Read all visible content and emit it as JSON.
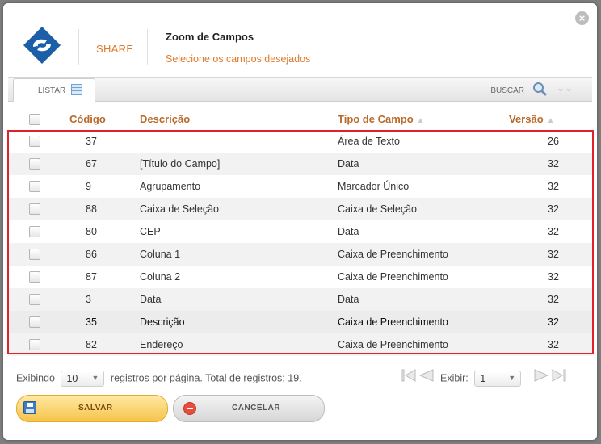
{
  "header": {
    "brand": "SHARE",
    "title": "Zoom de Campos",
    "subtitle": "Selecione os campos desejados",
    "close_icon": "×"
  },
  "toolbar": {
    "tab_label": "LISTAR",
    "search_label": "BUSCAR"
  },
  "table": {
    "columns": {
      "codigo": "Código",
      "descricao": "Descrição",
      "tipo": "Tipo de Campo",
      "versao": "Versão"
    },
    "rows": [
      {
        "codigo": "37",
        "descricao": "",
        "tipo": "Área de Texto",
        "versao": "26"
      },
      {
        "codigo": "67",
        "descricao": "[Título do Campo]",
        "tipo": "Data",
        "versao": "32"
      },
      {
        "codigo": "9",
        "descricao": "Agrupamento",
        "tipo": "Marcador Único",
        "versao": "32"
      },
      {
        "codigo": "88",
        "descricao": "Caixa de Seleção",
        "tipo": "Caixa de Seleção",
        "versao": "32"
      },
      {
        "codigo": "80",
        "descricao": "CEP",
        "tipo": "Data",
        "versao": "32"
      },
      {
        "codigo": "86",
        "descricao": "Coluna 1",
        "tipo": "Caixa de Preenchimento",
        "versao": "32"
      },
      {
        "codigo": "87",
        "descricao": "Coluna 2",
        "tipo": "Caixa de Preenchimento",
        "versao": "32"
      },
      {
        "codigo": "3",
        "descricao": "Data",
        "tipo": "Data",
        "versao": "32"
      },
      {
        "codigo": "35",
        "descricao": "Descrição",
        "tipo": "Caixa de Preenchimento",
        "versao": "32"
      },
      {
        "codigo": "82",
        "descricao": "Endereço",
        "tipo": "Caixa de Preenchimento",
        "versao": "32"
      }
    ]
  },
  "pager": {
    "showing_label": "Exibindo",
    "per_page": "10",
    "per_page_text": "registros por página. Total de registros: 19.",
    "exibir_label": "Exibir:",
    "page": "1"
  },
  "buttons": {
    "save": "SALVAR",
    "cancel": "CANCELAR"
  },
  "colors": {
    "accent": "#e07a2a",
    "header_text": "#b86a2a",
    "highlight": "#e0202a",
    "save_bg": "#f6c34a"
  }
}
